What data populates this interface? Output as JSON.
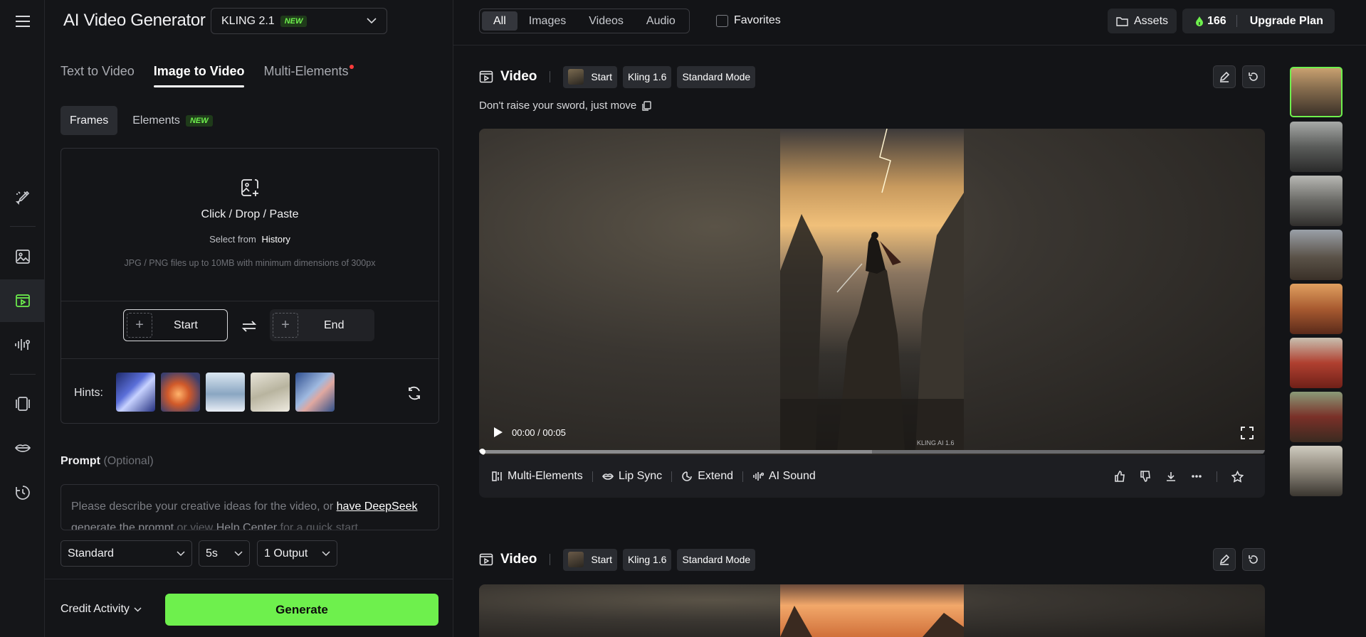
{
  "app": {
    "title": "AI Video Generator",
    "model": "KLING 2.1",
    "model_badge": "NEW"
  },
  "rail": {
    "items": [
      {
        "name": "menu-icon"
      },
      {
        "name": "brush-icon"
      },
      {
        "name": "image-icon"
      },
      {
        "name": "video-icon",
        "active": true
      },
      {
        "name": "audio-icon"
      },
      {
        "name": "elements-icon"
      },
      {
        "name": "lip-icon"
      },
      {
        "name": "history-icon"
      }
    ]
  },
  "mode_tabs": [
    "Text to Video",
    "Image to Video",
    "Multi-Elements"
  ],
  "sub_tabs": {
    "frames": "Frames",
    "elements": "Elements",
    "elements_badge": "NEW"
  },
  "upload": {
    "main": "Click / Drop / Paste",
    "select_from": "Select from",
    "history": "History",
    "note": "JPG / PNG files up to 10MB with minimum dimensions of 300px"
  },
  "frames": {
    "start": "Start",
    "end": "End"
  },
  "hints": {
    "label": "Hints:"
  },
  "prompt": {
    "label": "Prompt",
    "optional": "(Optional)",
    "placeholder_1": "Please describe your creative ideas for the video, or",
    "link": "have DeepSeek",
    "line2_link": "generate the prompt",
    "line2_rest": "or view",
    "help": "Help Center",
    "line2_end": "for a quick start"
  },
  "options": {
    "quality": "Standard",
    "duration": "5s",
    "outputs": "1 Output"
  },
  "bottom": {
    "credit_activity": "Credit Activity",
    "generate": "Generate"
  },
  "filters": {
    "items": [
      "All",
      "Images",
      "Videos",
      "Audio"
    ],
    "active": "All",
    "favorites": "Favorites"
  },
  "topbar": {
    "assets": "Assets",
    "credits": "166",
    "upgrade": "Upgrade Plan"
  },
  "cards": [
    {
      "title": "Video",
      "tags": [
        "Start",
        "Kling 1.6",
        "Standard Mode"
      ],
      "prompt": "Don't raise your sword, just move",
      "time": "00:00 / 00:05",
      "watermark": "KLING AI 1.6"
    },
    {
      "title": "Video",
      "tags": [
        "Start",
        "Kling 1.6",
        "Standard Mode"
      ]
    }
  ],
  "actions": [
    "Multi-Elements",
    "Lip Sync",
    "Extend",
    "AI Sound"
  ],
  "colors": {
    "accent": "#6ef04d",
    "badge_bg": "#1f3b1a",
    "alert": "#ff3b3b"
  }
}
